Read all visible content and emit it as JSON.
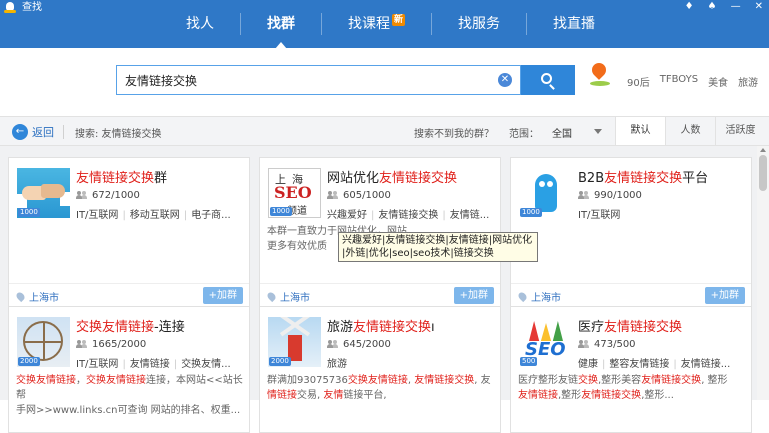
{
  "app": {
    "title": "查找",
    "controls": [
      "♦",
      "♠",
      "—",
      "✕"
    ]
  },
  "nav": {
    "items": [
      {
        "label": "找人"
      },
      {
        "label": "找群"
      },
      {
        "label": "找课程",
        "badge": "新"
      },
      {
        "label": "找服务"
      },
      {
        "label": "找直播"
      }
    ]
  },
  "search": {
    "value": "友情链接交换",
    "hot_tags": [
      "90后",
      "TFBOYS",
      "美食",
      "旅游"
    ]
  },
  "subbar": {
    "back_label": "返回",
    "summary": "搜索: 友情链接交换",
    "not_found": "搜索不到我的群？",
    "range_label": "范围：",
    "range_value": "全国",
    "sort": [
      "默认",
      "人数",
      "活跃度"
    ]
  },
  "cards": [
    {
      "title_hl": "友情链接交换",
      "title_rest": "群",
      "title_pre": "",
      "members": "672/1000",
      "tags": [
        "IT/互联网",
        "移动互联网",
        "电子商..."
      ],
      "location": "上海市",
      "join": "+加群",
      "badge": "1000"
    },
    {
      "title_pre": "网站优化",
      "title_hl": "友情链接交换",
      "title_rest": "",
      "members": "605/1000",
      "tags": [
        "兴趣爱好",
        "友情链接交换",
        "友情链..."
      ],
      "desc_1": "本群一直致力于网站优化，网站",
      "desc_2": "更多有效优质",
      "location": "上海市",
      "join": "+加群",
      "badge": "1000",
      "thumb_top": "上海",
      "thumb_mid": "SEO",
      "thumb_bot": "频道"
    },
    {
      "title_pre": "B2B",
      "title_hl": "友情链接交换",
      "title_rest": "平台",
      "members": "990/1000",
      "tags": [
        "IT/互联网"
      ],
      "location": "上海市",
      "join": "+加群",
      "badge": "1000"
    },
    {
      "title_pre": "",
      "title_hl": "交换友情链接",
      "title_rest": "-连接",
      "members": "1665/2000",
      "tags": [
        "IT/互联网",
        "友情链接",
        "交换友情..."
      ],
      "desc_hl1": "交换友情链接",
      "desc_a": "，",
      "desc_hl2": "交换友情链接",
      "desc_b": "连接，本网站<<站长帮",
      "desc_line2": "手网>>www.links.cn可查询 网站的排名、权重...",
      "badge": "2000"
    },
    {
      "title_pre": "旅游",
      "title_hl": "友情链接交换",
      "title_rest": "ı",
      "members": "645/2000",
      "tags": [
        "旅游"
      ],
      "desc_a": "群满加93075736",
      "desc_hl1": "交换友情链接",
      "desc_b": ", ",
      "desc_hl2": "友情链接交换",
      "desc_c": ", 友",
      "desc_hl3": "情链接",
      "desc_d": "交易, ",
      "desc_hl4": "友情",
      "desc_e": "链接平台,",
      "badge": "2000"
    },
    {
      "title_pre": "医疗",
      "title_hl": "友情链接交换",
      "title_rest": "",
      "members": "473/500",
      "tags": [
        "健康",
        "整容友情链接",
        "友情链接..."
      ],
      "desc_a": "医疗整形友链",
      "desc_hl1": "交换",
      "desc_b": ",整形美容",
      "desc_hl2": "友情链接交换",
      "desc_c": ", 整形",
      "desc_hl3": "友情链接",
      "desc_d": ",整形",
      "desc_hl4": "友情链接交换",
      "desc_e": ",整形...",
      "badge": "500",
      "thumb_text": "SEO"
    }
  ],
  "tooltip": {
    "line1": "兴趣爱好|友情链接交换|友情链接|网站优化",
    "line2": "|外链|优化|seo|seo技术|链接交换"
  },
  "colors": {
    "nav_bg": "#2f78c7",
    "highlight": "#e0221c",
    "link": "#2f6fbf"
  }
}
